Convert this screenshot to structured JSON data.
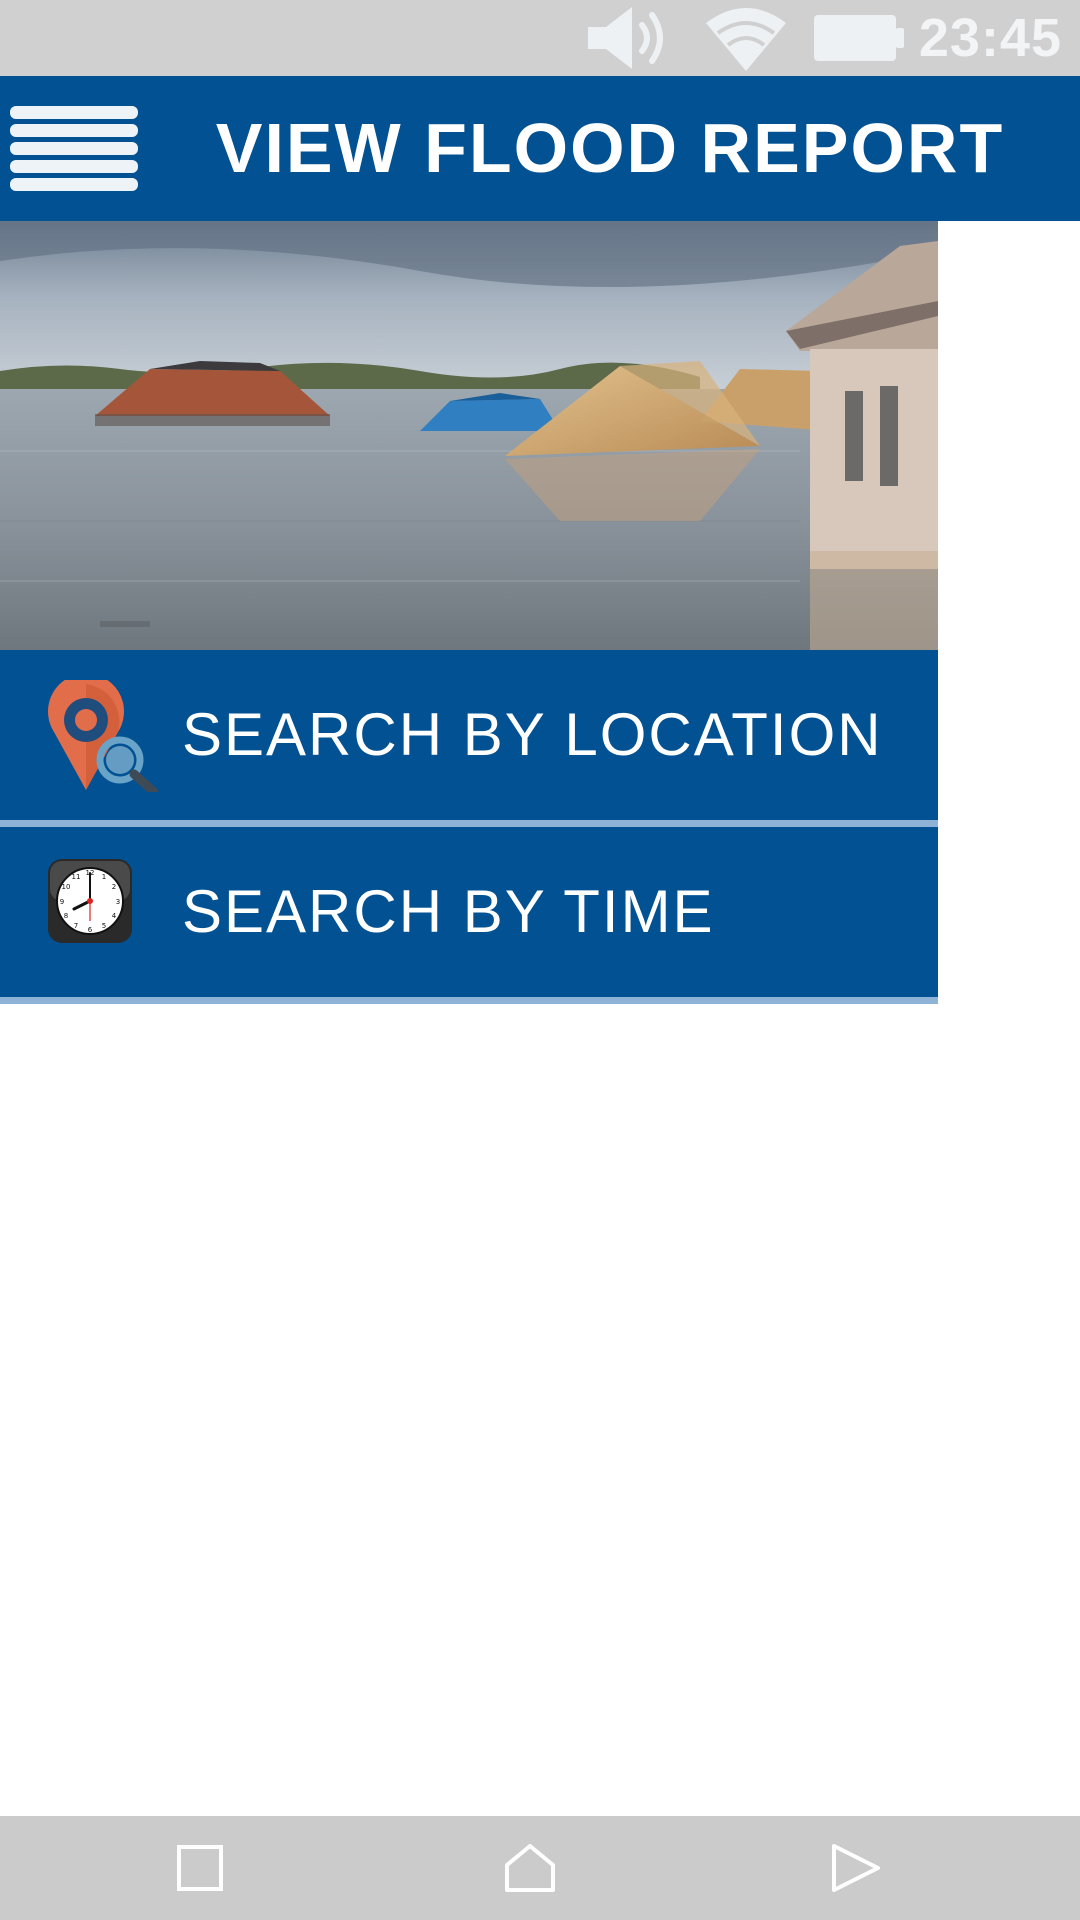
{
  "status_bar": {
    "time": "23:45",
    "icons": [
      "volume-icon",
      "wifi-icon",
      "battery-icon"
    ]
  },
  "app_bar": {
    "menu_icon": "hamburger-menu-icon",
    "title": "VIEW FLOOD REPORT"
  },
  "hero": {
    "image": "flooded-houses-photo"
  },
  "menu": {
    "items": [
      {
        "label": "SEARCH BY LOCATION",
        "icon": "location-search-icon"
      },
      {
        "label": "SEARCH BY TIME",
        "icon": "clock-icon"
      }
    ]
  },
  "nav_bar": {
    "icons": [
      "recent-apps-icon",
      "home-icon",
      "back-icon"
    ]
  },
  "colors": {
    "primary": "#015193",
    "divider": "#8fb3d6",
    "status_bar": "#d0d0d0",
    "nav_bar": "#cbcbcb",
    "pin_orange": "#e26d4a"
  }
}
